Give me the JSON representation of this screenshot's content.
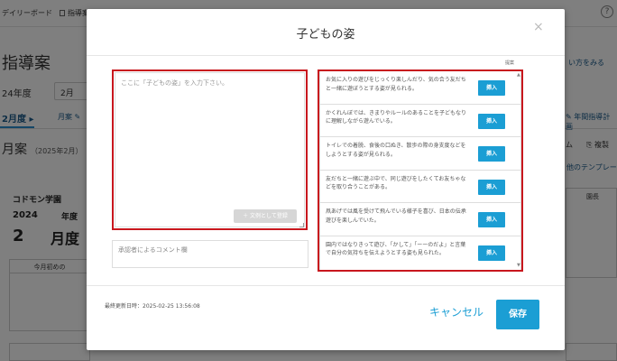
{
  "background": {
    "nav": {
      "daily_board": "デイリーボード",
      "guidance_plan": "指導案"
    },
    "title": "指導案",
    "year_label": "24年度",
    "month_value": "2月",
    "active_tab": "2月度",
    "month_tab": "月案",
    "subtitle": "月案",
    "subtitle_period": "（2025年2月）",
    "org_name": "コドモン学園",
    "year_value": "2024",
    "year_unit": "年度",
    "month_number": "2",
    "month_unit": "月度",
    "grid_header": "今月初めの",
    "right_help_link": "い方をみる",
    "right_annual_plan": "年間指導計画",
    "right_action_a": "ム",
    "right_action_b": "複製",
    "right_template": "他のテンプレー",
    "right_col_header": "園長"
  },
  "modal": {
    "title": "子どもの姿",
    "close_label": "×",
    "child_placeholder": "ここに「子どもの姿」を入力下さい。",
    "register_label": "＋ 文例として登録",
    "comment_placeholder": "承認者によるコメント欄",
    "suggest_label": "提案",
    "insert_label": "挿入",
    "suggestions": [
      "お気に入りの遊びをじっくり楽しんだり、気の合う友だちと一緒に遊ぼうとする姿が見られる。",
      "かくれんぼでは、きまりやルールのあることを子どもなりに理解しながら遊んでいる。",
      "トイレでの着脱、食後の口ぬき、散歩の際の身支度などをしようとする姿が見られる。",
      "友だちと一緒に遊ぶ中で、同じ遊びをしたくてお友ちゃなどを取り合うことがある。",
      "凧あげでは風を受けて飛んでいる様子を喜び、日本の伝承遊びを楽しんでいた。",
      "園内ではなりきって遊び、「かして」「ーーのだよ」と言葉で自分の気持ちを伝えようとする姿も見られた。"
    ],
    "last_updated": "最終更新日時：2025-02-25 13:56:08",
    "cancel_label": "キャンセル",
    "save_label": "保存"
  },
  "colors": {
    "accent": "#1b9ed4",
    "highlight": "#c8171e"
  }
}
